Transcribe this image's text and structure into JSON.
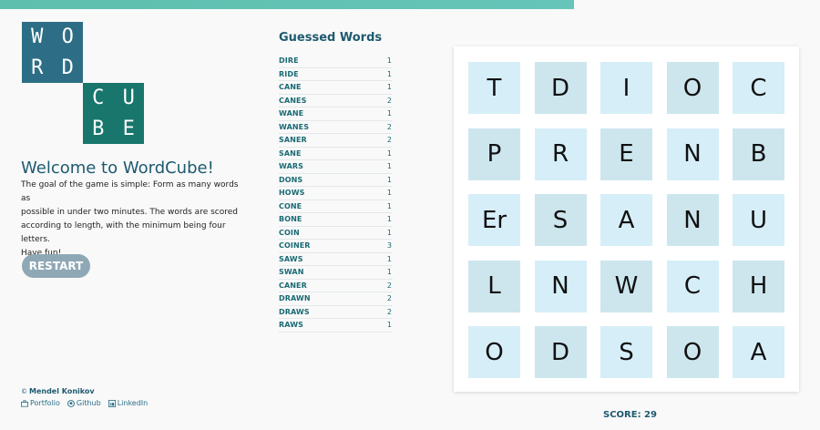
{
  "logo": {
    "top_letters": [
      "W",
      "O",
      "R",
      "D"
    ],
    "bottom_letters": [
      "C",
      "U",
      "B",
      "E"
    ]
  },
  "welcome": {
    "title": "Welcome to WordCube!",
    "lines": [
      "The goal of the game is simple: Form as many words as",
      "possible in under two minutes. The words are scored",
      "according to length, with the minimum being four",
      "letters.",
      "Have fun!"
    ]
  },
  "restart_label": "RESTART",
  "footer": {
    "copyright": "©",
    "author": "Mendel Konikov",
    "links": [
      {
        "label": "Portfolio",
        "icon": "briefcase-icon"
      },
      {
        "label": "Github",
        "icon": "github-icon"
      },
      {
        "label": "LinkedIn",
        "icon": "linkedin-icon"
      }
    ]
  },
  "guessed": {
    "title": "Guessed Words",
    "words": [
      {
        "word": "DIRE",
        "score": "1"
      },
      {
        "word": "RIDE",
        "score": "1"
      },
      {
        "word": "CANE",
        "score": "1"
      },
      {
        "word": "CANES",
        "score": "2"
      },
      {
        "word": "WANE",
        "score": "1"
      },
      {
        "word": "WANES",
        "score": "2"
      },
      {
        "word": "SANER",
        "score": "2"
      },
      {
        "word": "SANE",
        "score": "1"
      },
      {
        "word": "WARS",
        "score": "1"
      },
      {
        "word": "DONS",
        "score": "1"
      },
      {
        "word": "HOWS",
        "score": "1"
      },
      {
        "word": "CONE",
        "score": "1"
      },
      {
        "word": "BONE",
        "score": "1"
      },
      {
        "word": "COIN",
        "score": "1"
      },
      {
        "word": "COINER",
        "score": "3"
      },
      {
        "word": "SAWS",
        "score": "1"
      },
      {
        "word": "SWAN",
        "score": "1"
      },
      {
        "word": "CANER",
        "score": "2"
      },
      {
        "word": "DRAWN",
        "score": "2"
      },
      {
        "word": "DRAWS",
        "score": "2"
      },
      {
        "word": "RAWS",
        "score": "1"
      }
    ]
  },
  "board": {
    "rows": [
      [
        "T",
        "D",
        "I",
        "O",
        "C"
      ],
      [
        "P",
        "R",
        "E",
        "N",
        "B"
      ],
      [
        "Er",
        "S",
        "A",
        "N",
        "U"
      ],
      [
        "L",
        "N",
        "W",
        "C",
        "H"
      ],
      [
        "O",
        "D",
        "S",
        "O",
        "A"
      ]
    ],
    "colors": {
      "light": "#d6eef8",
      "dark": "#cde6ee"
    }
  },
  "score": "SCORE: 29"
}
